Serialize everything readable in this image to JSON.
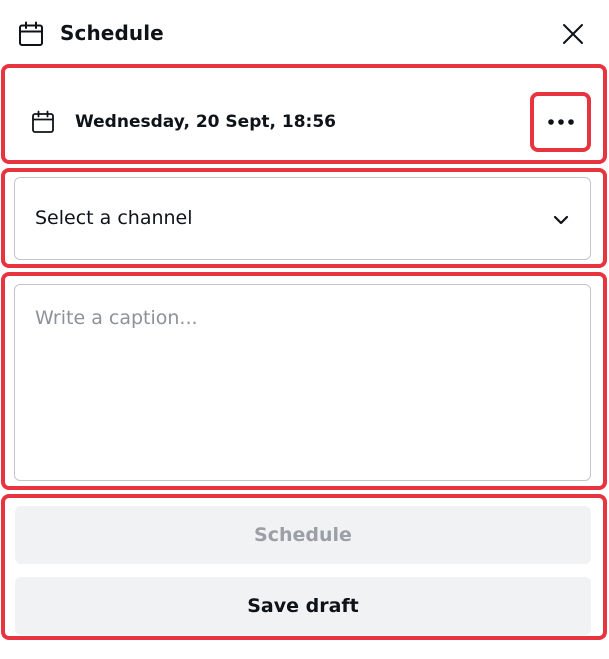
{
  "header": {
    "title": "Schedule",
    "icon": "calendar-icon",
    "close_icon": "close-icon"
  },
  "schedule": {
    "date_label": "Wednesday, 20 Sept, 18:56",
    "icon": "calendar-icon",
    "more_icon": "more-options-icon"
  },
  "channel": {
    "placeholder": "Select a channel",
    "icon": "chevron-down-icon"
  },
  "caption": {
    "placeholder": "Write a caption...",
    "value": ""
  },
  "actions": {
    "schedule_label": "Schedule",
    "save_draft_label": "Save draft"
  },
  "colors": {
    "highlight": "#e8343f",
    "button_bg": "#f1f2f4",
    "disabled_text": "#9aa0a6",
    "text": "#0e1318"
  }
}
